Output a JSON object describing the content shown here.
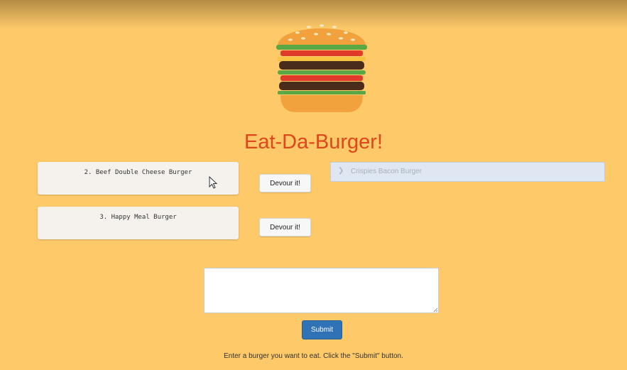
{
  "page": {
    "title": "Eat-Da-Burger!",
    "logo_icon": "burger-icon",
    "colors": {
      "background": "#fdc969",
      "title": "#e0461c",
      "submit_button": "#2f73b6",
      "devoured_item": "#dfe7f2"
    }
  },
  "not_devoured": [
    {
      "label": "2. Beef Double Cheese Burger",
      "button_label": "Devour it!"
    },
    {
      "label": "3. Happy Meal Burger",
      "button_label": "Devour it!"
    }
  ],
  "devoured": [
    {
      "label": "Crispies Bacon Burger",
      "icon": "chevron-right-icon"
    }
  ],
  "form": {
    "textarea_value": "",
    "submit_label": "Submit",
    "instructions": "Enter a burger you want to eat. Click the \"Submit\" button."
  }
}
